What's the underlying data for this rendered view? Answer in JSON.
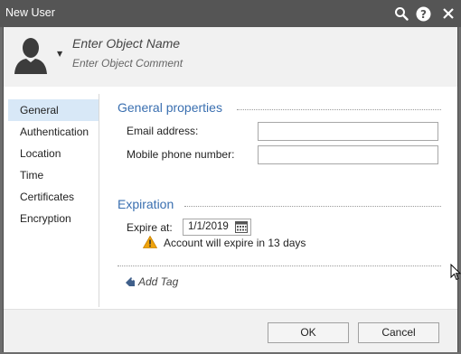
{
  "window": {
    "title": "New User"
  },
  "header": {
    "object_name_placeholder": "Enter Object Name",
    "object_comment_placeholder": "Enter Object Comment"
  },
  "nav": {
    "items": [
      {
        "label": "General"
      },
      {
        "label": "Authentication"
      },
      {
        "label": "Location"
      },
      {
        "label": "Time"
      },
      {
        "label": "Certificates"
      },
      {
        "label": "Encryption"
      }
    ],
    "selected": "General"
  },
  "general_properties": {
    "title": "General properties",
    "email_label": "Email address:",
    "email_value": "",
    "mobile_label": "Mobile phone number:",
    "mobile_value": ""
  },
  "expiration": {
    "title": "Expiration",
    "expire_label": "Expire at:",
    "expire_value": "1/1/2019",
    "warning": "Account will expire in 13 days"
  },
  "tags": {
    "add_label": "Add Tag"
  },
  "footer": {
    "ok_label": "OK",
    "cancel_label": "Cancel"
  },
  "icons": {
    "titlebar": [
      "search-icon",
      "help-icon",
      "close-icon"
    ],
    "avatar": "user-silhouette-icon",
    "calendar": "calendar-icon",
    "warning": "warning-icon",
    "tag": "tag-icon"
  },
  "colors": {
    "titlebar": "#555555",
    "section_title": "#3a6fb0",
    "nav_selected_bg": "#d8e8f7",
    "warning": "#f0a30a"
  }
}
